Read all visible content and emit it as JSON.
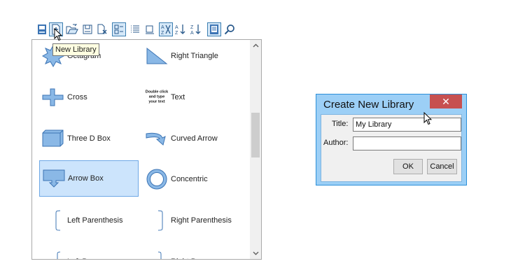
{
  "toolbar": {
    "buttons": [
      {
        "icon": "save-library-icon"
      },
      {
        "icon": "new-library-icon",
        "active": true
      },
      {
        "icon": "open-library-icon"
      },
      {
        "icon": "save-icon"
      },
      {
        "icon": "delete-library-icon"
      },
      {
        "icon": "large-icons-view-icon",
        "active": true
      },
      {
        "icon": "list-view-icon"
      },
      {
        "icon": "small-icons-view-icon"
      },
      {
        "icon": "sort-toggle-icon",
        "active": true
      },
      {
        "icon": "sort-ascending-icon"
      },
      {
        "icon": "sort-descending-icon"
      },
      {
        "icon": "library-book-icon",
        "active": true
      },
      {
        "icon": "search-icon"
      }
    ],
    "tooltip": "New Library"
  },
  "library": {
    "items": [
      {
        "label": "Octagram",
        "icon": "octagram-icon"
      },
      {
        "label": "Right Triangle",
        "icon": "right-triangle-icon"
      },
      {
        "label": "Cross",
        "icon": "cross-icon"
      },
      {
        "label": "Text",
        "icon": "text-shape-icon",
        "icon_text": "Double click and type your text"
      },
      {
        "label": "Three D Box",
        "icon": "three-d-box-icon"
      },
      {
        "label": "Curved Arrow",
        "icon": "curved-arrow-icon"
      },
      {
        "label": "Arrow Box",
        "icon": "arrow-box-icon",
        "selected": true
      },
      {
        "label": "Concentric",
        "icon": "concentric-icon"
      },
      {
        "label": "Left Parenthesis",
        "icon": "left-parenthesis-icon"
      },
      {
        "label": "Right Parenthesis",
        "icon": "right-parenthesis-icon"
      },
      {
        "label": "Left Brace",
        "icon": "left-brace-icon"
      },
      {
        "label": "Right Brace",
        "icon": "right-brace-icon"
      }
    ]
  },
  "dialog": {
    "title": "Create New Library",
    "close_glyph": "✕",
    "title_label": "Title:",
    "title_value": "My Library",
    "author_label": "Author:",
    "author_value": "",
    "ok_label": "OK",
    "cancel_label": "Cancel"
  },
  "colors": {
    "accent": "#3c7fb1",
    "shape_fill": "#8ab8e6",
    "shape_stroke": "#3c74b4",
    "selection": "#cce4fc",
    "dialog_frame": "#9ccff6",
    "close_red": "#c75050"
  }
}
